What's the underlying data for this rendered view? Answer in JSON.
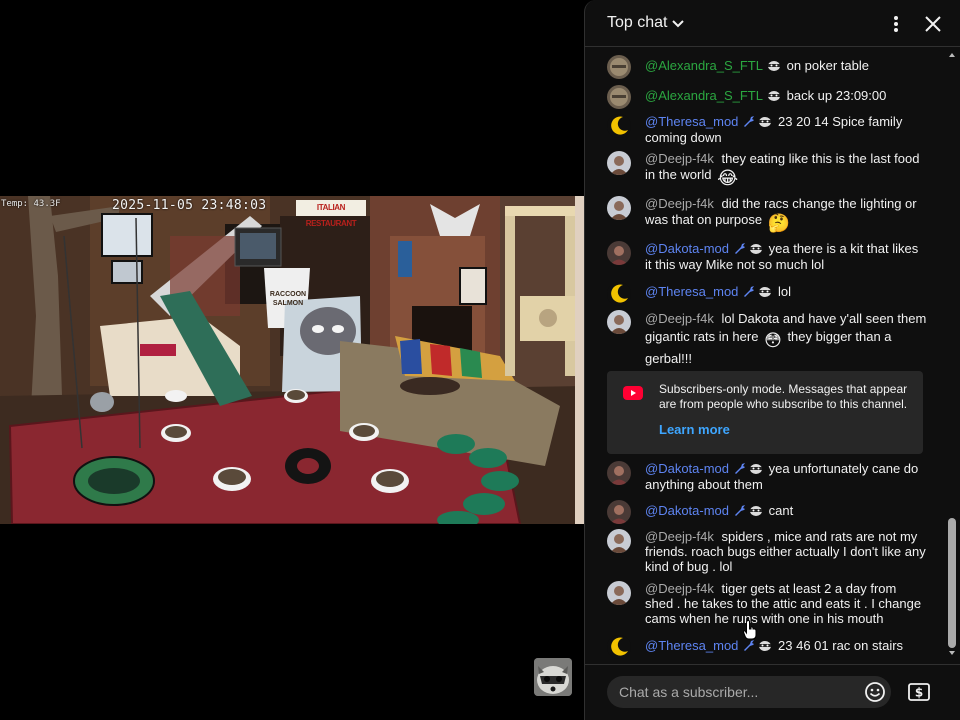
{
  "video": {
    "osd_temp": "Temp: 43.3F",
    "osd_timestamp": "2025-11-05 23:48:03",
    "sign_italian": "ITALIAN RESTAURANT",
    "sign_bucket": "RACCOON SALMON"
  },
  "chat": {
    "header": {
      "title": "Top chat",
      "dropdown_icon": "chevron-down-icon",
      "menu_icon": "more-vert-icon",
      "close_icon": "close-icon"
    },
    "messages": [
      {
        "author": "@Alexandra_S_FTL",
        "text": "on poker table"
      },
      {
        "author": "@Alexandra_S_FTL",
        "text": "back up 23:09:00"
      },
      {
        "author": "@Theresa_mod",
        "text": "23 20 14 Spice family coming down"
      },
      {
        "author": "@Deejp-f4k",
        "text": "they eating like this is the last food in the world",
        "emoji": "😂"
      },
      {
        "author": "@Deejp-f4k",
        "text": "did the racs change the lighting or was that on purpose",
        "emoji": "🤔"
      },
      {
        "author": "@Dakota-mod",
        "text": "yea there is a kit that likes it this way Mike not so much lol"
      },
      {
        "author": "@Theresa_mod",
        "text": "lol"
      },
      {
        "author": "@Deejp-f4k",
        "text": "lol Dakota and have y'all seen them gigantic rats in here",
        "emoji": "😳",
        "text_after": "they bigger than a gerbal!!!"
      },
      {
        "author": "@Dakota-mod",
        "text": "yea unfortunately cane do anything about them"
      },
      {
        "author": "@Dakota-mod",
        "text": "cant"
      },
      {
        "author": "@Deejp-f4k",
        "text": "spiders , mice and rats are not my friends. roach bugs either actually I don't like any kind of bug . lol"
      },
      {
        "author": "@Deejp-f4k",
        "text": "tiger gets at least 2 a day from shed . he takes to the attic and eats it . I change cams when he runs with one in his mouth"
      },
      {
        "author": "@Theresa_mod",
        "text": "23 46 01 rac on stairs"
      }
    ],
    "notice": {
      "icon": "youtube-icon",
      "text": "Subscribers-only mode. Messages that appear are from people who subscribe to this channel.",
      "link": "Learn more"
    },
    "input": {
      "placeholder": "Chat as a subscriber...",
      "emoji_icon": "emoji-icon",
      "super_chat_icon": "super-chat-icon"
    }
  },
  "colors": {
    "background": "#0f0f0f",
    "author_member": "#2ba640",
    "author_moderator": "#5e84f1",
    "author_viewer": "#aaaaaa",
    "link": "#3ea6ff",
    "notice_bg": "#272727"
  }
}
